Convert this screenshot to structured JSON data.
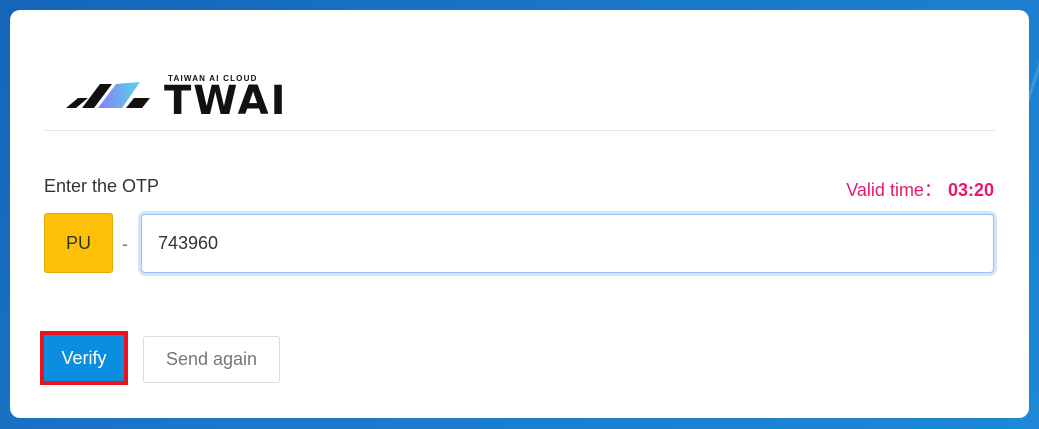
{
  "logo": {
    "subtitle": "TAIWAN AI CLOUD",
    "wordmark": "TWAI"
  },
  "otp": {
    "label": "Enter the OTP",
    "valid_label": "Valid time：",
    "valid_time": "03:20",
    "prefix": "PU",
    "separator": "-",
    "value": "743960"
  },
  "buttons": {
    "verify": "Verify",
    "send_again": "Send again"
  },
  "colors": {
    "accent": "#0b8ee0",
    "prefix_bg": "#ffc107",
    "timer": "#e6196e",
    "highlight": "#e8141f"
  }
}
